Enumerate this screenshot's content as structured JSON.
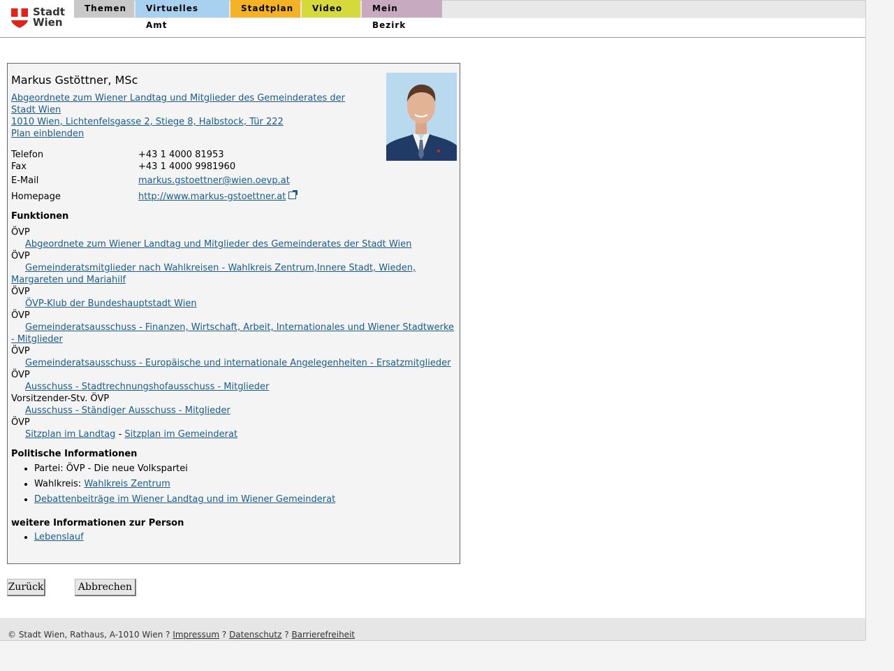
{
  "header": {
    "logo_text": [
      "Stadt",
      "Wien"
    ],
    "tabs": [
      {
        "label": "Themen",
        "color": "#c8c8c8"
      },
      {
        "label": "Virtuelles Amt",
        "color": "#a8d1ef"
      },
      {
        "label": "Stadtplan",
        "color": "#f4b324"
      },
      {
        "label": "Video",
        "color": "#d6d93a"
      },
      {
        "label": "Mein Bezirk",
        "color": "#c8aac0"
      }
    ]
  },
  "person": {
    "name": "Markus Gstöttner, MSc",
    "role_link": "Abgeordnete zum Wiener Landtag und Mitglieder des Gemeinderates der Stadt Wien",
    "address_link": "1010 Wien, Lichtenfelsgasse 2, Stiege 8, Halbstock, Tür 222",
    "plan_link": "Plan einblenden"
  },
  "contact": [
    {
      "label": "Telefon",
      "value": "+43 1 4000 81953"
    },
    {
      "label": "Fax",
      "value": "+43 1 4000 9981960"
    },
    {
      "label": "E-Mail",
      "value": "markus.gstoettner@wien.oevp.at"
    },
    {
      "label": "Homepage",
      "value": "http://www.markus-gstoettner.at"
    }
  ],
  "functions": {
    "heading": "Funktionen",
    "items": [
      {
        "party": "ÖVP",
        "link": "Abgeordnete zum Wiener Landtag und Mitglieder des Gemeinderates der Stadt Wien"
      },
      {
        "party": "ÖVP",
        "link": "Gemeinderatsmitglieder nach Wahlkreisen - Wahlkreis Zentrum,Innere Stadt, Wieden, Margareten und Mariahilf"
      },
      {
        "party": "ÖVP",
        "link": "ÖVP-Klub der Bundeshauptstadt Wien"
      },
      {
        "party": "ÖVP",
        "link": "Gemeinderatsausschuss - Finanzen, Wirtschaft, Arbeit, Internationales und Wiener Stadtwerke - Mitglieder"
      },
      {
        "party": "ÖVP",
        "link": "Gemeinderatsausschuss - Europäische und internationale Angelegenheiten - Ersatzmitglieder"
      },
      {
        "party": "ÖVP",
        "link": "Ausschuss - Stadtrechnungshofausschuss - Mitglieder"
      },
      {
        "party": "Vorsitzender-Stv. ÖVP",
        "link": "Ausschuss - Ständiger Ausschuss - Mitglieder"
      }
    ],
    "last_party": "ÖVP",
    "seat_landtag": "Sitzplan im Landtag",
    "separator": "-",
    "seat_gemeinderat": "Sitzplan im Gemeinderat"
  },
  "political": {
    "heading": "Politische Informationen",
    "party_label": "Partei:",
    "party_value": "ÖVP - Die neue Volkspartei",
    "district_label": "Wahlkreis:",
    "district_link": "Wahlkreis Zentrum",
    "debates_link": "Debattenbeiträge im Wiener Landtag und im Wiener Gemeinderat"
  },
  "more_info": {
    "heading": "weitere Informationen zur Person",
    "cv_link": "Lebenslauf"
  },
  "buttons": {
    "back": "Zurück",
    "cancel": "Abbrechen"
  },
  "footer": {
    "copyright": "© Stadt Wien, Rathaus, A-1010 Wien ?",
    "impressum": "Impressum",
    "sep1": "?",
    "datenschutz": "Datenschutz",
    "sep2": "?",
    "barrierefreiheit": "Barrierefreiheit"
  }
}
